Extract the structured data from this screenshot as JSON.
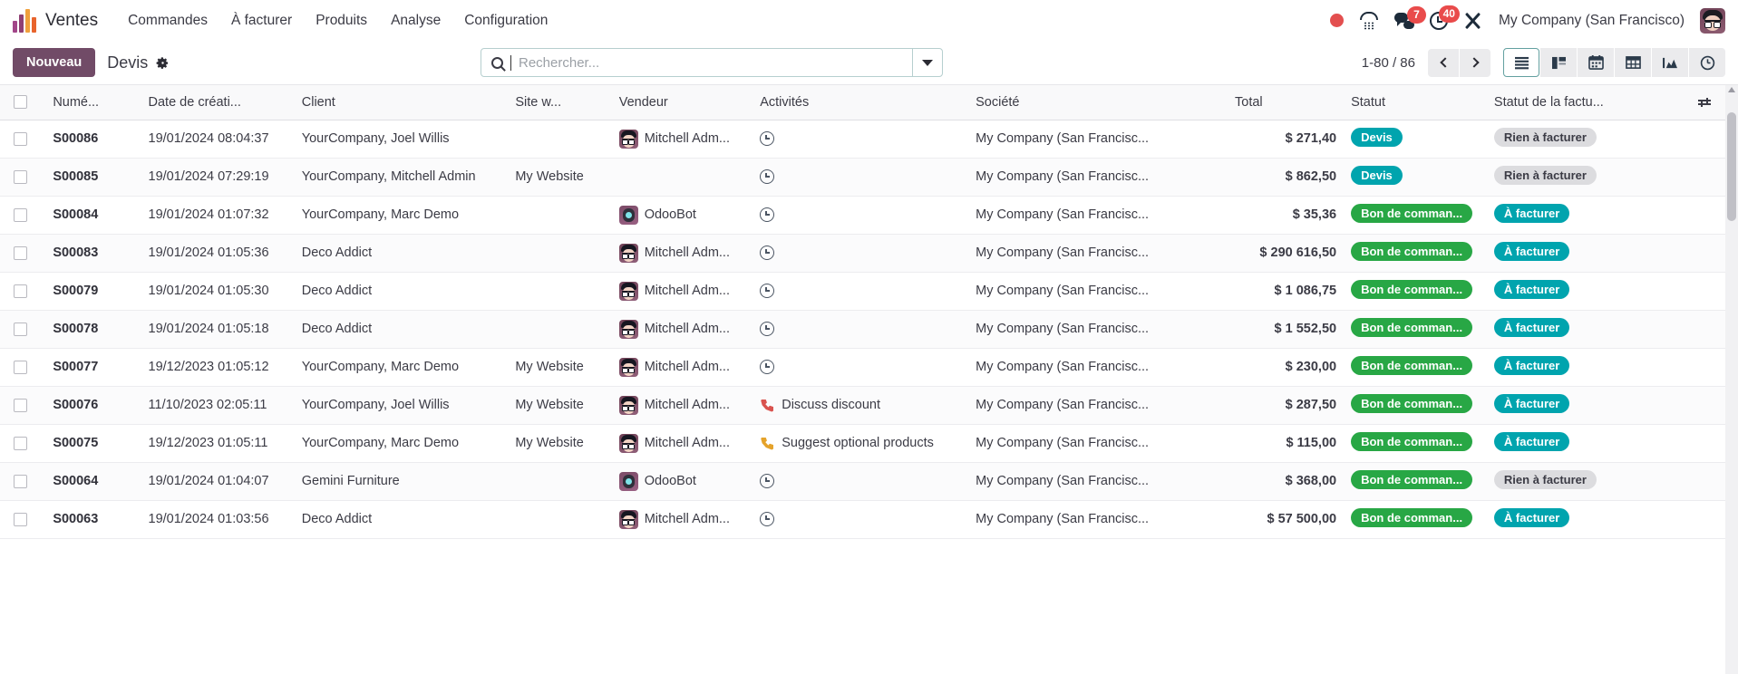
{
  "navbar": {
    "app_title": "Ventes",
    "menu_items": [
      "Commandes",
      "À facturer",
      "Produits",
      "Analyse",
      "Configuration"
    ],
    "recording_icon": "record-dot-icon",
    "phone_icon": "phone-icon",
    "chat_icon": "chat-icon",
    "chat_badge": "7",
    "activity_icon": "clock-icon",
    "activity_badge": "40",
    "tools_icon": "tools-icon",
    "company": "My Company (San Francisco)",
    "avatar_icon": "user-avatar"
  },
  "control_panel": {
    "new_label": "Nouveau",
    "breadcrumb": "Devis",
    "gear_icon": "gear-icon",
    "search": {
      "placeholder": "Rechercher...",
      "value": "",
      "icon": "search-icon",
      "dropdown_icon": "chevron-down-icon"
    },
    "pager": "1-80 / 86",
    "prev_icon": "chevron-left-icon",
    "next_icon": "chevron-right-icon",
    "views": [
      {
        "name": "list",
        "icon": "list-view-icon",
        "active": true
      },
      {
        "name": "kanban",
        "icon": "kanban-view-icon",
        "active": false
      },
      {
        "name": "calendar",
        "icon": "calendar-view-icon",
        "active": false
      },
      {
        "name": "pivot",
        "icon": "pivot-view-icon",
        "active": false
      },
      {
        "name": "graph",
        "icon": "graph-view-icon",
        "active": false
      },
      {
        "name": "activity",
        "icon": "activity-view-icon",
        "active": false
      }
    ]
  },
  "table": {
    "columns": [
      "Numé...",
      "Date de créati...",
      "Client",
      "Site w...",
      "Vendeur",
      "Activités",
      "Société",
      "Total",
      "Statut",
      "Statut de la factu..."
    ],
    "options_icon": "column-options-icon",
    "rows": [
      {
        "ref": "S00086",
        "date": "19/01/2024 08:04:37",
        "client": "YourCompany, Joel Willis",
        "site": "",
        "vendor": "Mitchell Adm...",
        "vendor_avatar": "mitchell",
        "activity_text": "",
        "activity_icon": "clock-icon",
        "activity_kind": "",
        "company": "My Company (San Francisc...",
        "total": "$ 271,40",
        "state": "Devis",
        "state_kind": "devis",
        "invoice_state": "Rien à facturer",
        "invoice_kind": "noinv"
      },
      {
        "ref": "S00085",
        "date": "19/01/2024 07:29:19",
        "client": "YourCompany, Mitchell Admin",
        "site": "My Website",
        "vendor": "",
        "vendor_avatar": "",
        "activity_text": "",
        "activity_icon": "clock-icon",
        "activity_kind": "",
        "company": "My Company (San Francisc...",
        "total": "$ 862,50",
        "state": "Devis",
        "state_kind": "devis",
        "invoice_state": "Rien à facturer",
        "invoice_kind": "noinv"
      },
      {
        "ref": "S00084",
        "date": "19/01/2024 01:07:32",
        "client": "YourCompany, Marc Demo",
        "site": "",
        "vendor": "OdooBot",
        "vendor_avatar": "odoobot",
        "activity_text": "",
        "activity_icon": "clock-icon",
        "activity_kind": "",
        "company": "My Company (San Francisc...",
        "total": "$ 35,36",
        "state": "Bon de comman...",
        "state_kind": "sale",
        "invoice_state": "À facturer",
        "invoice_kind": "toinv"
      },
      {
        "ref": "S00083",
        "date": "19/01/2024 01:05:36",
        "client": "Deco Addict",
        "site": "",
        "vendor": "Mitchell Adm...",
        "vendor_avatar": "mitchell",
        "activity_text": "",
        "activity_icon": "clock-icon",
        "activity_kind": "",
        "company": "My Company (San Francisc...",
        "total": "$ 290 616,50",
        "state": "Bon de comman...",
        "state_kind": "sale",
        "invoice_state": "À facturer",
        "invoice_kind": "toinv"
      },
      {
        "ref": "S00079",
        "date": "19/01/2024 01:05:30",
        "client": "Deco Addict",
        "site": "",
        "vendor": "Mitchell Adm...",
        "vendor_avatar": "mitchell",
        "activity_text": "",
        "activity_icon": "clock-icon",
        "activity_kind": "",
        "company": "My Company (San Francisc...",
        "total": "$ 1 086,75",
        "state": "Bon de comman...",
        "state_kind": "sale",
        "invoice_state": "À facturer",
        "invoice_kind": "toinv"
      },
      {
        "ref": "S00078",
        "date": "19/01/2024 01:05:18",
        "client": "Deco Addict",
        "site": "",
        "vendor": "Mitchell Adm...",
        "vendor_avatar": "mitchell",
        "activity_text": "",
        "activity_icon": "clock-icon",
        "activity_kind": "",
        "company": "My Company (San Francisc...",
        "total": "$ 1 552,50",
        "state": "Bon de comman...",
        "state_kind": "sale",
        "invoice_state": "À facturer",
        "invoice_kind": "toinv"
      },
      {
        "ref": "S00077",
        "date": "19/12/2023 01:05:12",
        "client": "YourCompany, Marc Demo",
        "site": "My Website",
        "vendor": "Mitchell Adm...",
        "vendor_avatar": "mitchell",
        "activity_text": "",
        "activity_icon": "clock-icon",
        "activity_kind": "",
        "company": "My Company (San Francisc...",
        "total": "$ 230,00",
        "state": "Bon de comman...",
        "state_kind": "sale",
        "invoice_state": "À facturer",
        "invoice_kind": "toinv"
      },
      {
        "ref": "S00076",
        "date": "11/10/2023 02:05:11",
        "client": "YourCompany, Joel Willis",
        "site": "My Website",
        "vendor": "Mitchell Adm...",
        "vendor_avatar": "mitchell",
        "activity_text": "Discuss discount",
        "activity_icon": "phone-icon",
        "activity_kind": "overdue",
        "company": "My Company (San Francisc...",
        "total": "$ 287,50",
        "state": "Bon de comman...",
        "state_kind": "sale",
        "invoice_state": "À facturer",
        "invoice_kind": "toinv"
      },
      {
        "ref": "S00075",
        "date": "19/12/2023 01:05:11",
        "client": "YourCompany, Marc Demo",
        "site": "My Website",
        "vendor": "Mitchell Adm...",
        "vendor_avatar": "mitchell",
        "activity_text": "Suggest optional products",
        "activity_icon": "phone-icon",
        "activity_kind": "today",
        "company": "My Company (San Francisc...",
        "total": "$ 115,00",
        "state": "Bon de comman...",
        "state_kind": "sale",
        "invoice_state": "À facturer",
        "invoice_kind": "toinv"
      },
      {
        "ref": "S00064",
        "date": "19/01/2024 01:04:07",
        "client": "Gemini Furniture",
        "site": "",
        "vendor": "OdooBot",
        "vendor_avatar": "odoobot",
        "activity_text": "",
        "activity_icon": "clock-icon",
        "activity_kind": "",
        "company": "My Company (San Francisc...",
        "total": "$ 368,00",
        "state": "Bon de comman...",
        "state_kind": "sale",
        "invoice_state": "Rien à facturer",
        "invoice_kind": "noinv"
      },
      {
        "ref": "S00063",
        "date": "19/01/2024 01:03:56",
        "client": "Deco Addict",
        "site": "",
        "vendor": "Mitchell Adm...",
        "vendor_avatar": "mitchell",
        "activity_text": "",
        "activity_icon": "clock-icon",
        "activity_kind": "",
        "company": "My Company (San Francisc...",
        "total": "$ 57 500,00",
        "state": "Bon de comman...",
        "state_kind": "sale",
        "invoice_state": "À facturer",
        "invoice_kind": "toinv"
      }
    ]
  },
  "colors": {
    "brand_purple": "#714b67",
    "teal": "#00a4ae",
    "green": "#28a745",
    "link_blue": "#00759a",
    "badge_red": "#e94b4b"
  }
}
